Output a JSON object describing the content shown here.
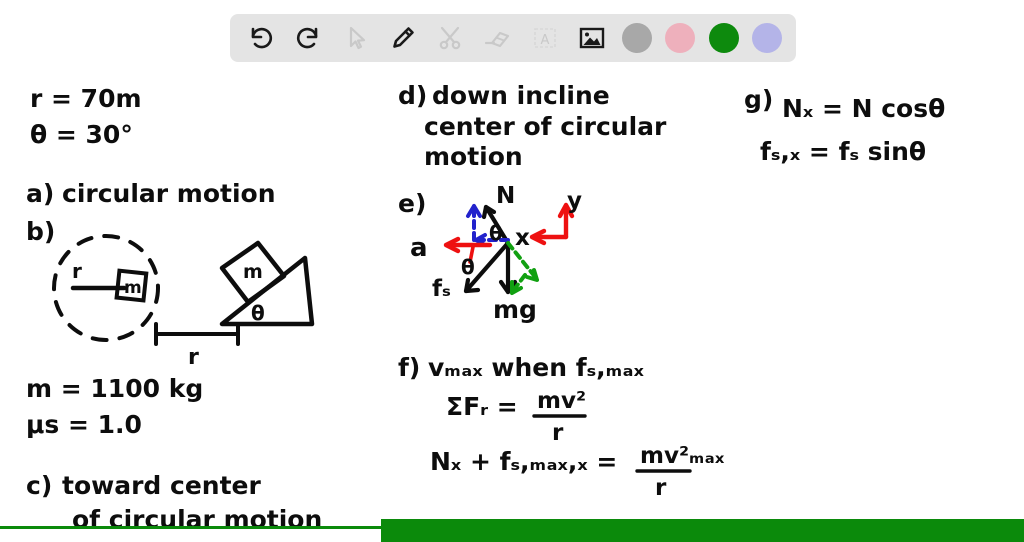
{
  "app": {
    "background_color": "#ffffff",
    "accent_green": "#0b8a0b"
  },
  "toolbar": {
    "background_color": "#e4e4e4",
    "items": [
      {
        "name": "undo-icon",
        "label": "Undo",
        "state": "enabled",
        "color": "#1a1a1a"
      },
      {
        "name": "redo-icon",
        "label": "Redo",
        "state": "enabled",
        "color": "#1a1a1a"
      },
      {
        "name": "cursor-icon",
        "label": "Select",
        "state": "disabled",
        "color": "#c9c9c9"
      },
      {
        "name": "pencil-icon",
        "label": "Pen",
        "state": "enabled",
        "color": "#1a1a1a"
      },
      {
        "name": "scissors-icon",
        "label": "Cut",
        "state": "disabled",
        "color": "#c9c9c9"
      },
      {
        "name": "eraser-icon",
        "label": "Eraser",
        "state": "disabled",
        "color": "#c9c9c9"
      },
      {
        "name": "text-icon",
        "label": "Text",
        "state": "disabled",
        "color": "#c9c9c9"
      },
      {
        "name": "image-icon",
        "label": "Image",
        "state": "active",
        "color": "#1a1a1a"
      }
    ],
    "swatches": [
      {
        "name": "swatch-gray",
        "label": "Gray",
        "color": "#a8a8a8"
      },
      {
        "name": "swatch-pink",
        "label": "Pink",
        "color": "#eeb0bc"
      },
      {
        "name": "swatch-green",
        "label": "Green",
        "color": "#0d8a0d"
      },
      {
        "name": "swatch-purple",
        "label": "Purple",
        "color": "#b4b4e8"
      }
    ]
  },
  "notes": {
    "givens": {
      "radius": "r = 70m",
      "angle": "θ = 30°",
      "mass": "m = 1100 kg",
      "friction": "μs = 1.0"
    },
    "part_a": {
      "label": "a)",
      "text": "circular motion"
    },
    "part_b": {
      "label": "b)",
      "diagram_labels": {
        "radius_line": "r",
        "block_top": "m",
        "block_incline": "m",
        "angle": "θ",
        "dimension": "r"
      }
    },
    "part_c": {
      "label": "c)",
      "line1": "toward center",
      "line2": "of circular motion"
    },
    "part_d": {
      "label": "d)",
      "line1": "down incline",
      "line2": "center of circular",
      "line3": "motion"
    },
    "part_e": {
      "label": "e)",
      "force_labels": {
        "normal": "N",
        "friction": "fₛ",
        "weight": "mg",
        "acceleration": "a",
        "axis_x": "x",
        "axis_y": "y",
        "angle_upper": "θ",
        "angle_lower": "θ"
      },
      "colors": {
        "vectors": "#0d0d0d",
        "axes": "#ee1111",
        "normal_components": "#2222cc",
        "weight_component": "#11a011"
      }
    },
    "part_f": {
      "label": "f)",
      "line1": "vₘₐₓ when fₛ,ₘₐₓ",
      "eq1_left": "ΣFᵣ =",
      "eq1_num": "mv²",
      "eq1_den": "r",
      "eq2_left": "Nₓ + fₛ,ₘₐₓ,ₓ =",
      "eq2_num": "mv²ₘₐₓ",
      "eq2_den": "r"
    },
    "part_g": {
      "label": "g)",
      "eq_blue": "Nₓ = N cosθ",
      "eq_red": "fₛ,ₓ = fₛ sinθ",
      "blue": "#2222cc",
      "red": "#ee1111"
    }
  }
}
